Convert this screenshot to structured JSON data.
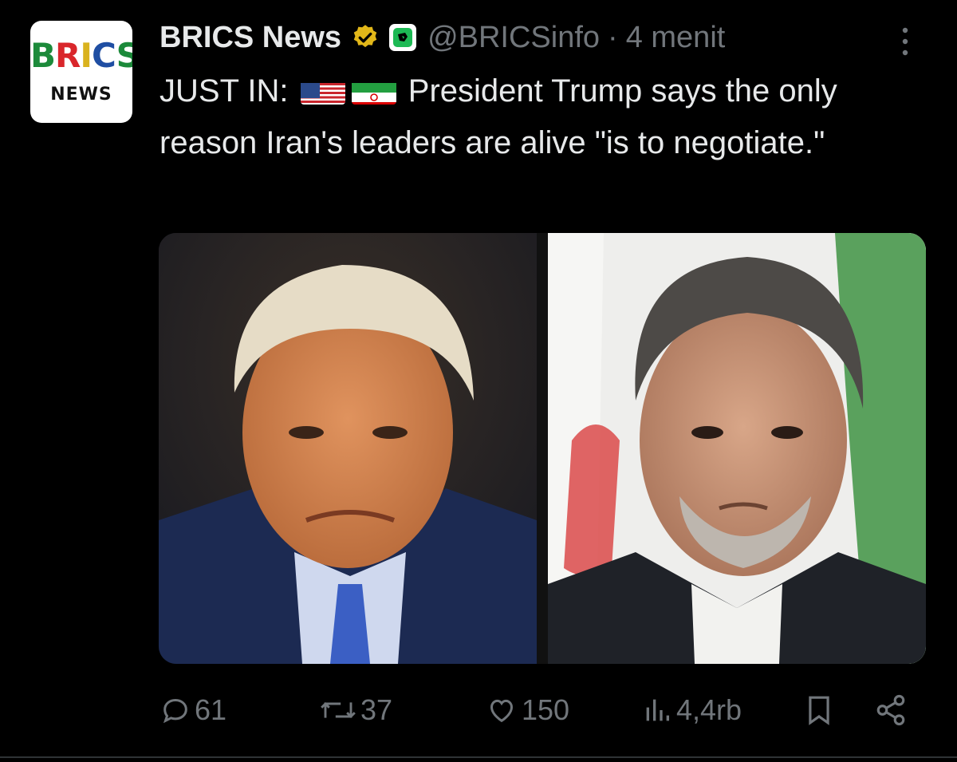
{
  "account": {
    "display_name": "BRICS News",
    "handle": "@BRICSinfo",
    "separator": "·",
    "time": "4 menit",
    "avatar": {
      "line1": "BRICS",
      "line2": "NEWS"
    },
    "verified_icon": "gold-verified-badge-icon",
    "affiliate_icon": "affiliate-badge-icon"
  },
  "tweet": {
    "prefix": "JUST IN:",
    "flags": [
      "us-flag-icon",
      "iran-flag-icon"
    ],
    "text": "President Trump says the only reason Iran's leaders are alive \"is to negotiate.\""
  },
  "media": {
    "items": [
      "photo-left",
      "photo-right"
    ]
  },
  "actions": {
    "replies": "61",
    "reposts": "37",
    "likes": "150",
    "views": "4,4rb"
  },
  "colors": {
    "background": "#000000",
    "text": "#e7e9ea",
    "muted": "#71767b",
    "verified_gold": "#e2b719"
  }
}
